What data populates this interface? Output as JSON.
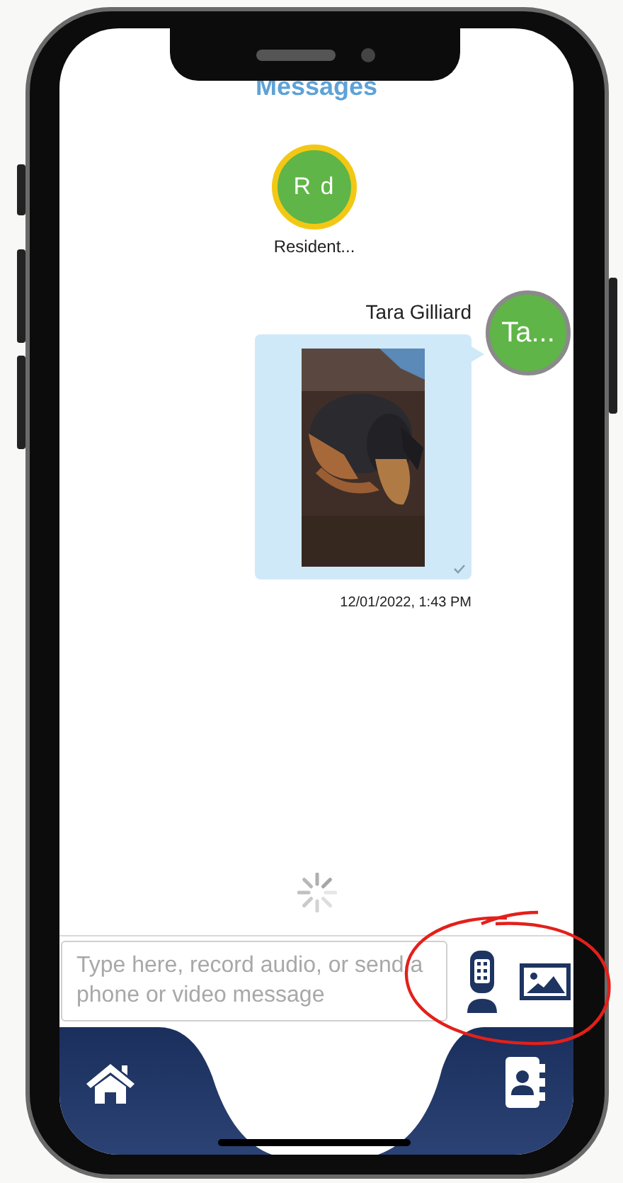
{
  "header": {
    "title": "Messages"
  },
  "participants": [
    {
      "initials": "R d",
      "name": "Resident..."
    }
  ],
  "messages": [
    {
      "sender": "Tara Gilliard",
      "avatar_initials": "Ta...",
      "read": true,
      "timestamp": "12/01/2022, 1:43 PM"
    }
  ],
  "loading": true,
  "composer": {
    "placeholder": "Type here, record audio, or send a phone or video message"
  }
}
